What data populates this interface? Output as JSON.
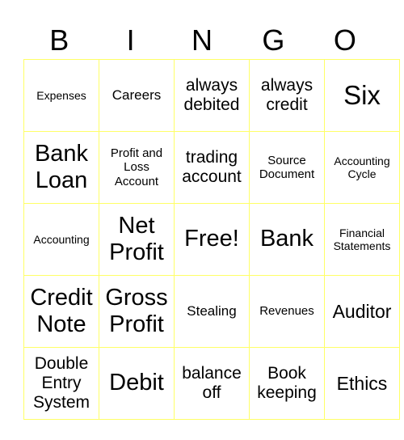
{
  "header": [
    "B",
    "I",
    "N",
    "G",
    "O"
  ],
  "rows": [
    [
      "Expenses",
      "Careers",
      "always debited",
      "always credit",
      "Six"
    ],
    [
      "Bank Loan",
      "Profit and Loss Account",
      "trading account",
      "Source Document",
      "Accounting Cycle"
    ],
    [
      "Accounting",
      "Net Profit",
      "Free!",
      "Bank",
      "Financial Statements"
    ],
    [
      "Credit Note",
      "Gross Profit",
      "Stealing",
      "Revenues",
      "Auditor"
    ],
    [
      "Double Entry System",
      "Debit",
      "balance off",
      "Book keeping",
      "Ethics"
    ]
  ],
  "colors": {
    "border": "#ffff66"
  }
}
